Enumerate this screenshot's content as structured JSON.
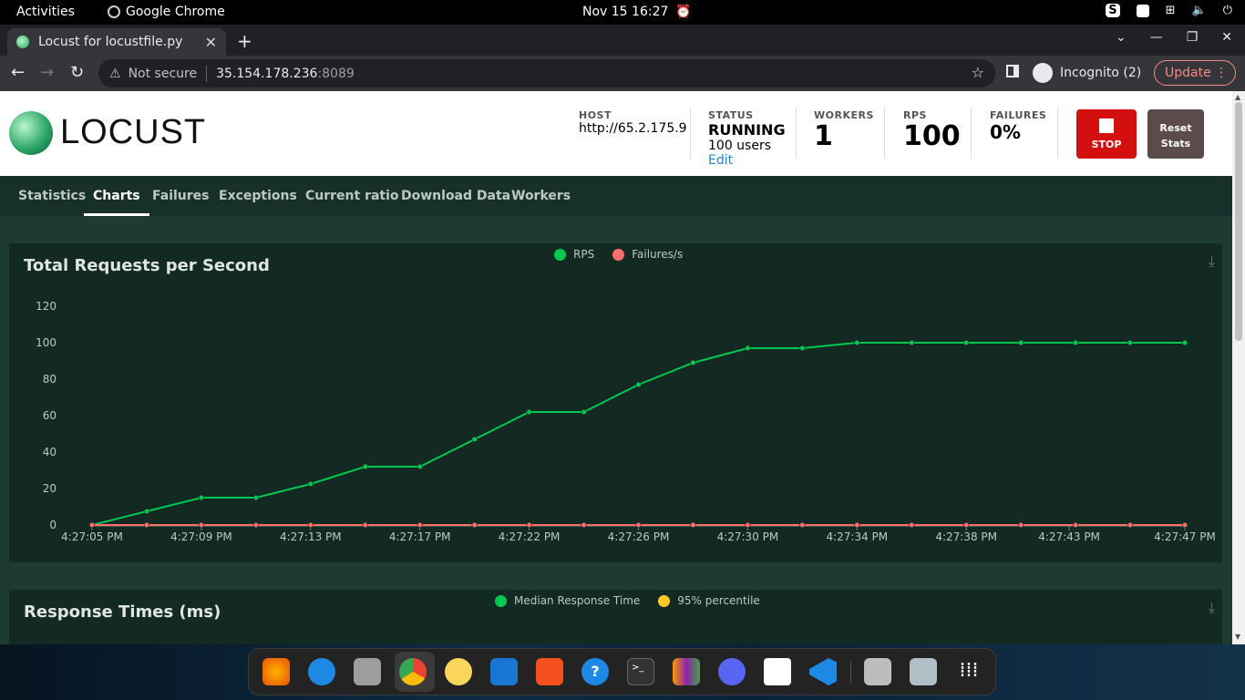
{
  "os": {
    "activities": "Activities",
    "app_name": "Google Chrome",
    "clock": "Nov 15  16:27"
  },
  "browser": {
    "tab_title": "Locust for locustfile.py",
    "not_secure": "Not secure",
    "url_host": "35.154.178.236",
    "url_port": ":8089",
    "incognito": "Incognito (2)",
    "update": "Update"
  },
  "header": {
    "logo_text": "LOCUST",
    "host_label": "HOST",
    "host_value": "http://65.2.175.9",
    "status_label": "STATUS",
    "status_value": "RUNNING",
    "users_value": "100 users",
    "edit_label": "Edit",
    "workers_label": "WORKERS",
    "workers_value": "1",
    "rps_label": "RPS",
    "rps_value": "100",
    "failures_label": "FAILURES",
    "failures_value": "0%",
    "stop_label": "STOP",
    "reset_label_1": "Reset",
    "reset_label_2": "Stats"
  },
  "nav": {
    "tabs": [
      "Statistics",
      "Charts",
      "Failures",
      "Exceptions",
      "Current ratio",
      "Download Data",
      "Workers"
    ],
    "active": "Charts"
  },
  "charts": {
    "rps_title": "Total Requests per Second",
    "rt_title": "Response Times (ms)",
    "rt_legend": [
      "Median Response Time",
      "95% percentile"
    ]
  },
  "colors": {
    "rps": "#00c853",
    "failures": "#ff6d6d",
    "median": "#00c853",
    "p95": "#ffca28"
  },
  "chart_data": {
    "type": "line",
    "title": "Total Requests per Second",
    "x": [
      "4:27:05 PM",
      "4:27:07 PM",
      "4:27:09 PM",
      "4:27:11 PM",
      "4:27:13 PM",
      "4:27:15 PM",
      "4:27:17 PM",
      "4:27:19 PM",
      "4:27:22 PM",
      "4:27:24 PM",
      "4:27:26 PM",
      "4:27:28 PM",
      "4:27:30 PM",
      "4:27:32 PM",
      "4:27:34 PM",
      "4:27:36 PM",
      "4:27:38 PM",
      "4:27:40 PM",
      "4:27:43 PM",
      "4:27:47 PM"
    ],
    "x_tick_labels": [
      "4:27:05 PM",
      "4:27:09 PM",
      "4:27:13 PM",
      "4:27:17 PM",
      "4:27:22 PM",
      "4:27:26 PM",
      "4:27:30 PM",
      "4:27:34 PM",
      "4:27:38 PM",
      "4:27:43 PM",
      "4:27:47 PM"
    ],
    "series": [
      {
        "name": "RPS",
        "values": [
          0,
          7.5,
          15,
          15,
          22.5,
          32,
          32,
          47,
          62,
          62,
          77,
          89,
          97,
          97,
          100,
          100,
          100,
          100,
          100,
          100,
          100
        ]
      },
      {
        "name": "Failures/s",
        "values": [
          0,
          0,
          0,
          0,
          0,
          0,
          0,
          0,
          0,
          0,
          0,
          0,
          0,
          0,
          0,
          0,
          0,
          0,
          0,
          0,
          0
        ]
      }
    ],
    "y_ticks": [
      0,
      20,
      40,
      60,
      80,
      100,
      120
    ],
    "ylim": [
      0,
      120
    ],
    "legend": "top-center",
    "grid": false
  }
}
